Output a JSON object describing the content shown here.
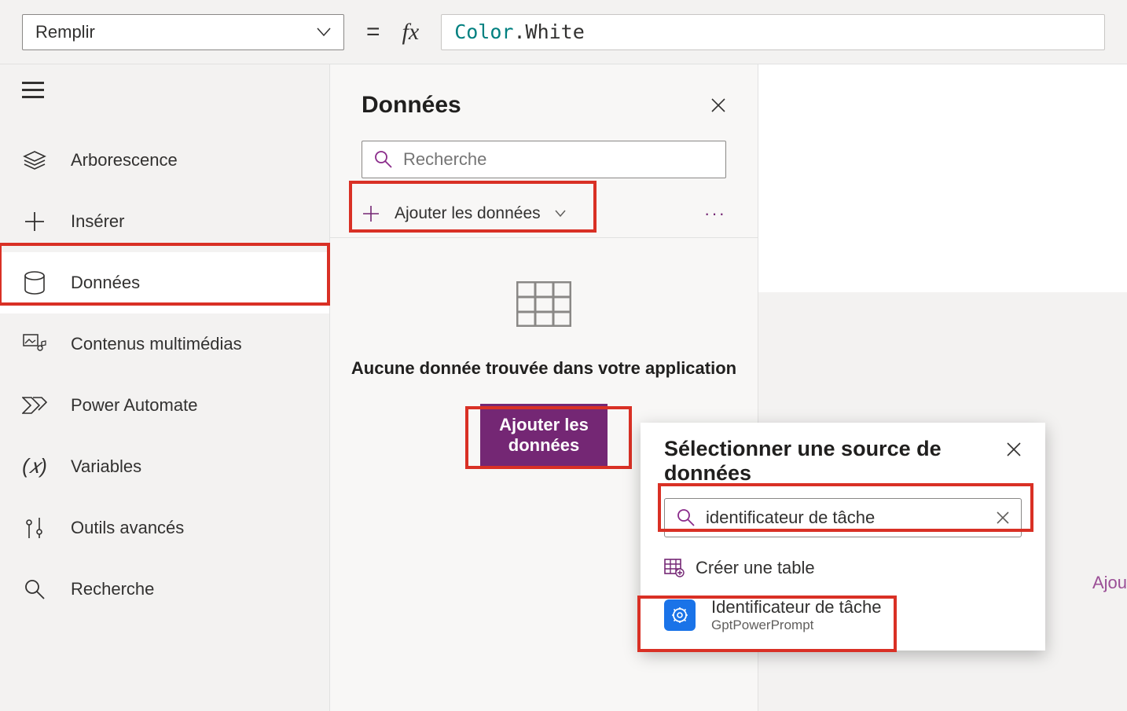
{
  "formula_bar": {
    "property": "Remplir",
    "sep": "=",
    "fx": "fx",
    "tokens": {
      "type": "Color",
      "dot": ".",
      "member": "White"
    }
  },
  "rail": {
    "items": [
      {
        "label": "Arborescence"
      },
      {
        "label": "Insérer"
      },
      {
        "label": "Données"
      },
      {
        "label": "Contenus multimédias"
      },
      {
        "label": "Power Automate"
      },
      {
        "label": "Variables"
      },
      {
        "label": "Outils avancés"
      },
      {
        "label": "Recherche"
      }
    ]
  },
  "data_panel": {
    "title": "Données",
    "search_placeholder": "Recherche",
    "add_label": "Ajouter les données",
    "more": "···",
    "empty_text": "Aucune donnée trouvée dans votre application",
    "cta": "Ajouter les\ndonnées"
  },
  "flyout": {
    "title": "Sélectionner une source de données",
    "search_value": "identificateur de tâche",
    "create_label": "Créer une table",
    "result": {
      "name": "Identificateur de tâche",
      "sub": "GptPowerPrompt"
    }
  },
  "canvas": {
    "hint": "Ajou"
  }
}
